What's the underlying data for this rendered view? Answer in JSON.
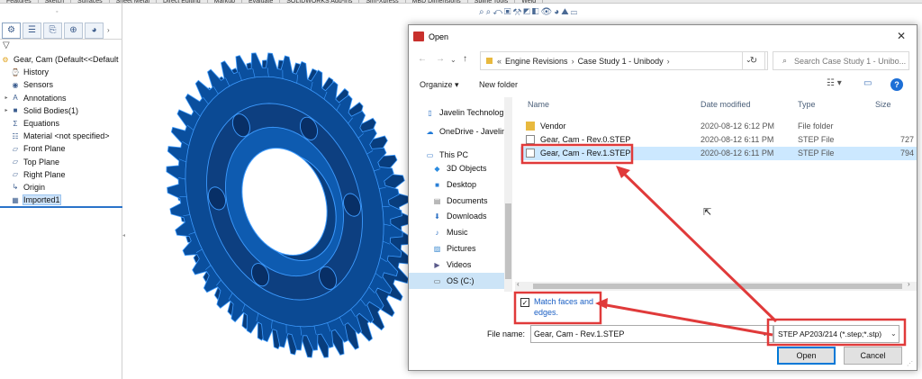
{
  "app": {
    "tabs": [
      "Features",
      "Sketch",
      "Surfaces",
      "Sheet Metal",
      "Direct Editing",
      "Markup",
      "Evaluate",
      "SOLIDWORKS Add-Ins",
      "Sim-Xpress",
      "MBD Dimensions",
      "Spline Tools",
      "Weld"
    ]
  },
  "feature_tree": {
    "items": [
      {
        "label": "Gear, Cam  (Default<<Default",
        "icon": "part-icon",
        "expand": ""
      },
      {
        "label": "History",
        "icon": "history-icon",
        "expand": ""
      },
      {
        "label": "Sensors",
        "icon": "sensors-icon",
        "expand": ""
      },
      {
        "label": "Annotations",
        "icon": "annotations-icon",
        "expand": "▸"
      },
      {
        "label": "Solid Bodies(1)",
        "icon": "solid-bodies-icon",
        "expand": "▸"
      },
      {
        "label": "Equations",
        "icon": "equations-icon",
        "expand": ""
      },
      {
        "label": "Material <not specified>",
        "icon": "material-icon",
        "expand": ""
      },
      {
        "label": "Front Plane",
        "icon": "plane-icon",
        "expand": ""
      },
      {
        "label": "Top Plane",
        "icon": "plane-icon",
        "expand": ""
      },
      {
        "label": "Right Plane",
        "icon": "plane-icon",
        "expand": ""
      },
      {
        "label": "Origin",
        "icon": "origin-icon",
        "expand": ""
      },
      {
        "label": "Imported1",
        "icon": "imported-feature-icon",
        "expand": ""
      }
    ]
  },
  "dialog": {
    "title": "Open",
    "address": {
      "prefix": "«",
      "crumbs": [
        "Engine Revisions",
        "Case Study 1 - Unibody"
      ]
    },
    "search_placeholder": "Search Case Study 1 - Unibo...",
    "toolbar": {
      "organize": "Organize ▾",
      "new_folder": "New folder"
    },
    "nav": [
      {
        "label": "Javelin Technologie",
        "icon": "computer-icon"
      },
      {
        "label": "OneDrive - Javelin",
        "icon": "onedrive-icon"
      },
      {
        "label": "This PC",
        "icon": "this-pc-icon"
      },
      {
        "label": "3D Objects",
        "icon": "3d-objects-icon"
      },
      {
        "label": "Desktop",
        "icon": "desktop-icon"
      },
      {
        "label": "Documents",
        "icon": "documents-icon"
      },
      {
        "label": "Downloads",
        "icon": "downloads-icon"
      },
      {
        "label": "Music",
        "icon": "music-icon"
      },
      {
        "label": "Pictures",
        "icon": "pictures-icon"
      },
      {
        "label": "Videos",
        "icon": "videos-icon"
      },
      {
        "label": "OS (C:)",
        "icon": "drive-icon"
      }
    ],
    "columns": {
      "name": "Name",
      "date": "Date modified",
      "type": "Type",
      "size": "Size"
    },
    "files": [
      {
        "name": "Vendor",
        "date": "2020-08-12 6:12 PM",
        "type": "File folder",
        "size": "",
        "kind": "folder"
      },
      {
        "name": "Gear, Cam - Rev.0.STEP",
        "date": "2020-08-12 6:11 PM",
        "type": "STEP File",
        "size": "727",
        "kind": "file"
      },
      {
        "name": "Gear, Cam - Rev.1.STEP",
        "date": "2020-08-12 6:11 PM",
        "type": "STEP File",
        "size": "794",
        "kind": "file"
      }
    ],
    "match_faces": {
      "label": "Match faces and edges.",
      "checked": true
    },
    "file_name_label": "File name:",
    "file_name_value": "Gear, Cam - Rev.1.STEP",
    "file_type_value": "STEP AP203/214 (*.step;*.stp)",
    "open_label": "Open",
    "cancel_label": "Cancel"
  },
  "colors": {
    "annotation": "#e03a3a",
    "selection": "#cce8ff",
    "gear_fill": "#0a4f9e",
    "gear_edge": "#3d9bff"
  }
}
